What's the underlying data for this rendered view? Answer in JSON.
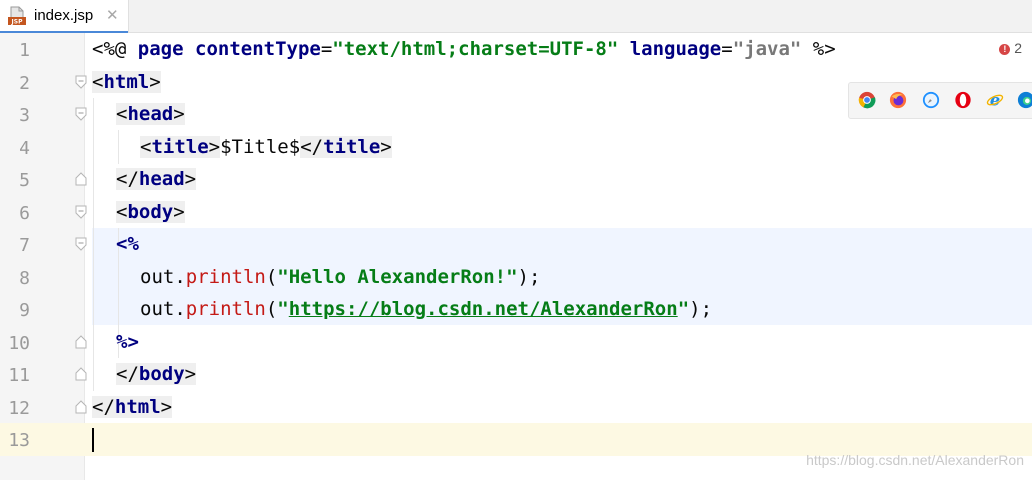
{
  "tab": {
    "label": "index.jsp",
    "close_glyph": "✕",
    "icon": "jsp-file-icon"
  },
  "lines": [
    {
      "num": "1",
      "directive": "<%@",
      "page": "page",
      "attr1": "contentType",
      "eq": "=",
      "val1": "\"text/html;charset=UTF-8\"",
      "attr2": "language",
      "val2": "\"java\"",
      "close": "%>"
    },
    {
      "num": "2",
      "open": "<",
      "tag": "html",
      "close": ">"
    },
    {
      "num": "3",
      "open": "<",
      "tag": "head",
      "close": ">"
    },
    {
      "num": "4",
      "open": "<",
      "tag": "title",
      "close": ">",
      "text": "$Title$",
      "end_open": "</",
      "end_tag": "title",
      "end_close": ">"
    },
    {
      "num": "5",
      "open": "</",
      "tag": "head",
      "close": ">"
    },
    {
      "num": "6",
      "open": "<",
      "tag": "body",
      "close": ">"
    },
    {
      "num": "7",
      "scriptlet": "<%"
    },
    {
      "num": "8",
      "obj": "out.",
      "method": "println",
      "paren_open": "(",
      "str": "\"Hello AlexanderRon!\"",
      "paren_close": ");"
    },
    {
      "num": "9",
      "obj": "out.",
      "method": "println",
      "paren_open": "(",
      "quote_open": "\"",
      "url": "https://blog.csdn.net/AlexanderRon",
      "quote_close": "\"",
      "paren_close": ");"
    },
    {
      "num": "10",
      "scriptlet": "%>"
    },
    {
      "num": "11",
      "open": "</",
      "tag": "body",
      "close": ">"
    },
    {
      "num": "12",
      "open": "</",
      "tag": "html",
      "close": ">"
    },
    {
      "num": "13"
    }
  ],
  "inspection": {
    "count": "2",
    "icon": "error-icon"
  },
  "browsers": [
    "chrome-icon",
    "firefox-icon",
    "safari-icon",
    "opera-icon",
    "ie-icon",
    "edge-icon"
  ],
  "watermark": "https://blog.csdn.net/AlexanderRon",
  "colors": {
    "tag": "#000080",
    "string": "#067d17",
    "method": "#c41a16",
    "current_line": "#fdf9e3",
    "jsp_block": "#f0f5ff"
  }
}
